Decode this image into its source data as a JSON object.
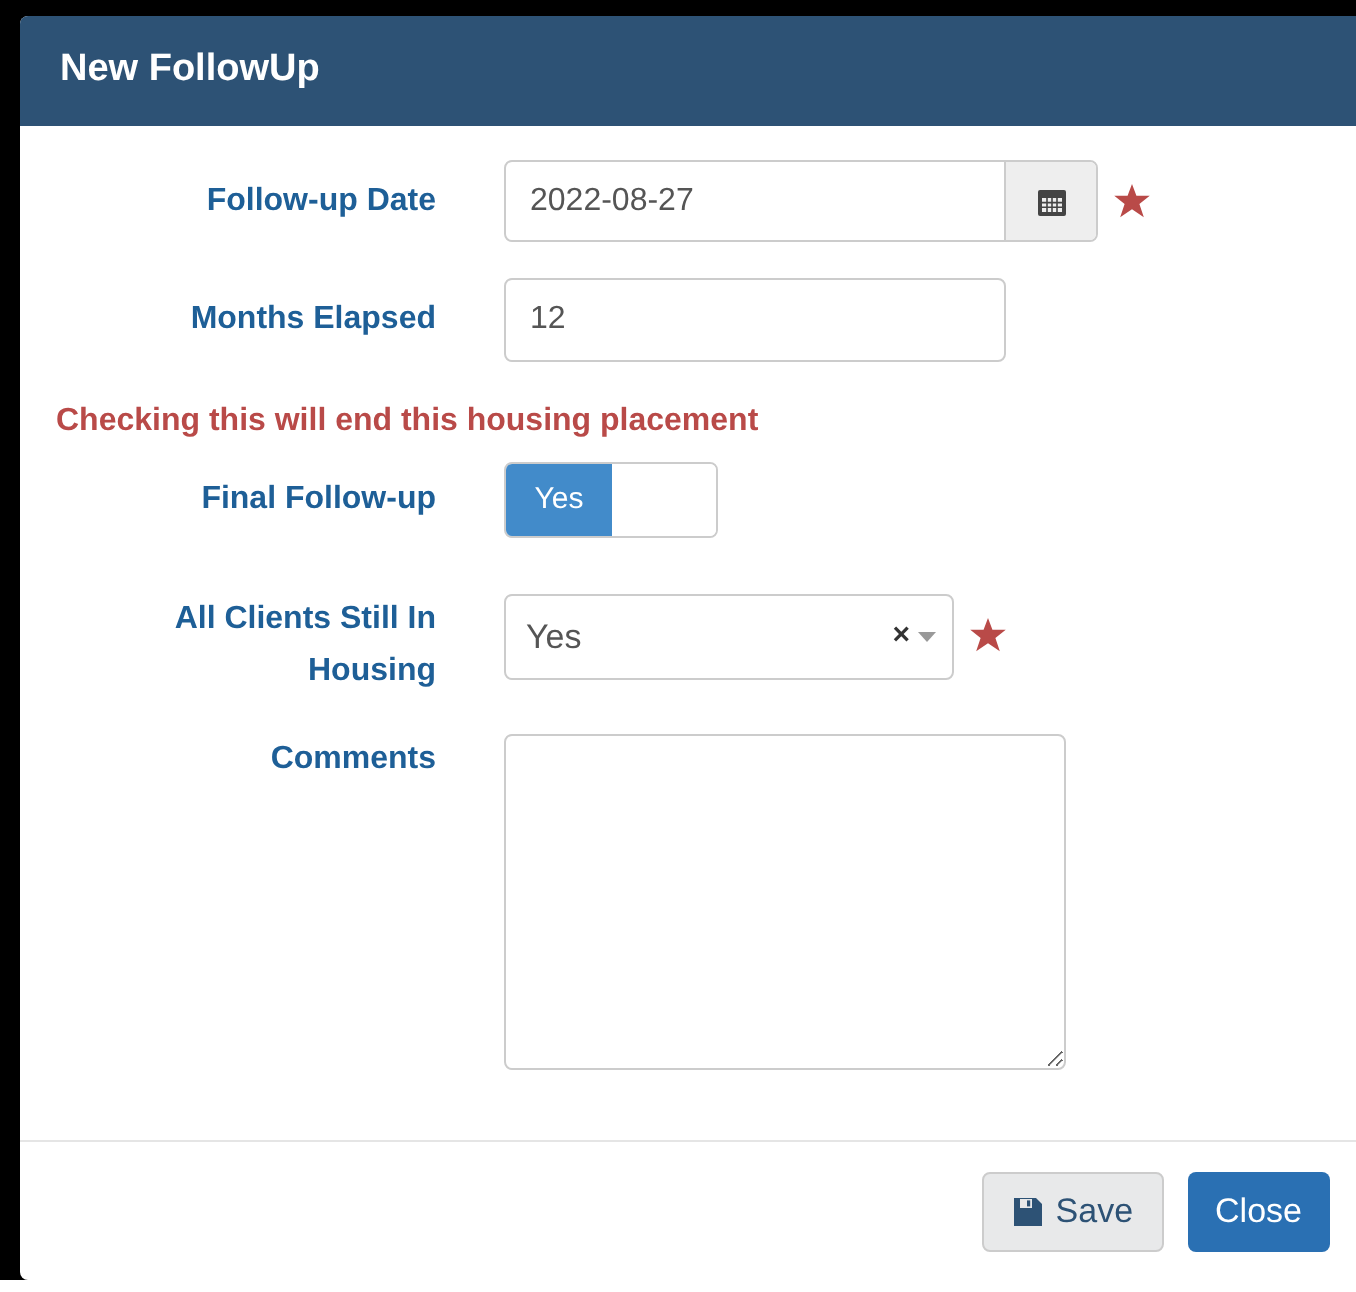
{
  "dialog": {
    "title": "New FollowUp"
  },
  "fields": [
    {
      "kind": "date",
      "label": "Follow-up Date",
      "value": "2022-08-27",
      "required": true
    },
    {
      "kind": "text",
      "label": "Months Elapsed",
      "value": "12"
    },
    {
      "kind": "warning",
      "text": "Checking this will end this housing placement"
    },
    {
      "kind": "toggle",
      "label": "Final Follow-up",
      "on_label": "Yes",
      "on": true
    },
    {
      "kind": "select",
      "label": "All Clients Still In Housing",
      "value": "Yes",
      "clear": "×",
      "required": true
    },
    {
      "kind": "textarea",
      "label": "Comments"
    }
  ],
  "buttons": [
    {
      "label": "Save",
      "kind": "save"
    },
    {
      "label": "Close",
      "kind": "primary"
    }
  ]
}
